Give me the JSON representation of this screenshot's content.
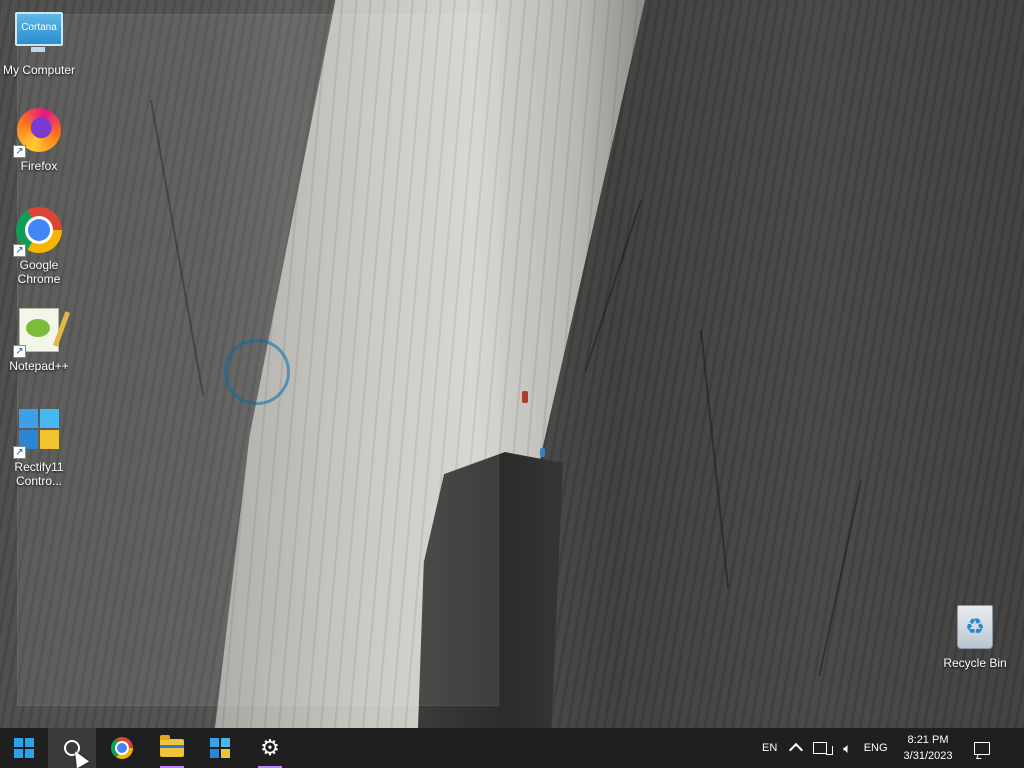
{
  "desktop": {
    "icons": [
      {
        "label": "My Computer",
        "overlay_text": "Cortana",
        "icon": "monitor-icon"
      },
      {
        "label": "Firefox",
        "icon": "firefox-icon"
      },
      {
        "label": "Google Chrome",
        "icon": "chrome-icon"
      },
      {
        "label": "Notepad++",
        "icon": "notepad-plus-plus-icon"
      },
      {
        "label": "Rectify11 Contro...",
        "icon": "rectify11-icon"
      },
      {
        "label": "Recycle Bin",
        "icon": "recycle-bin-icon"
      }
    ]
  },
  "taskbar": {
    "apps": [
      {
        "name": "Start",
        "icon": "windows-logo-icon"
      },
      {
        "name": "Search",
        "icon": "search-icon"
      },
      {
        "name": "Google Chrome",
        "icon": "chrome-icon"
      },
      {
        "name": "File Explorer",
        "icon": "folder-icon"
      },
      {
        "name": "Rectify11",
        "icon": "rectify11-icon"
      },
      {
        "name": "Settings",
        "icon": "gear-icon"
      }
    ],
    "tray": {
      "input_lang": "EN",
      "keyboard_lang": "ENG",
      "time": "8:21 PM",
      "date": "3/31/2023"
    }
  },
  "colors": {
    "taskbar_bg": "#1f1f1f",
    "windows_blue": "#2aa4ee",
    "active_indicator": "#c084fc"
  }
}
